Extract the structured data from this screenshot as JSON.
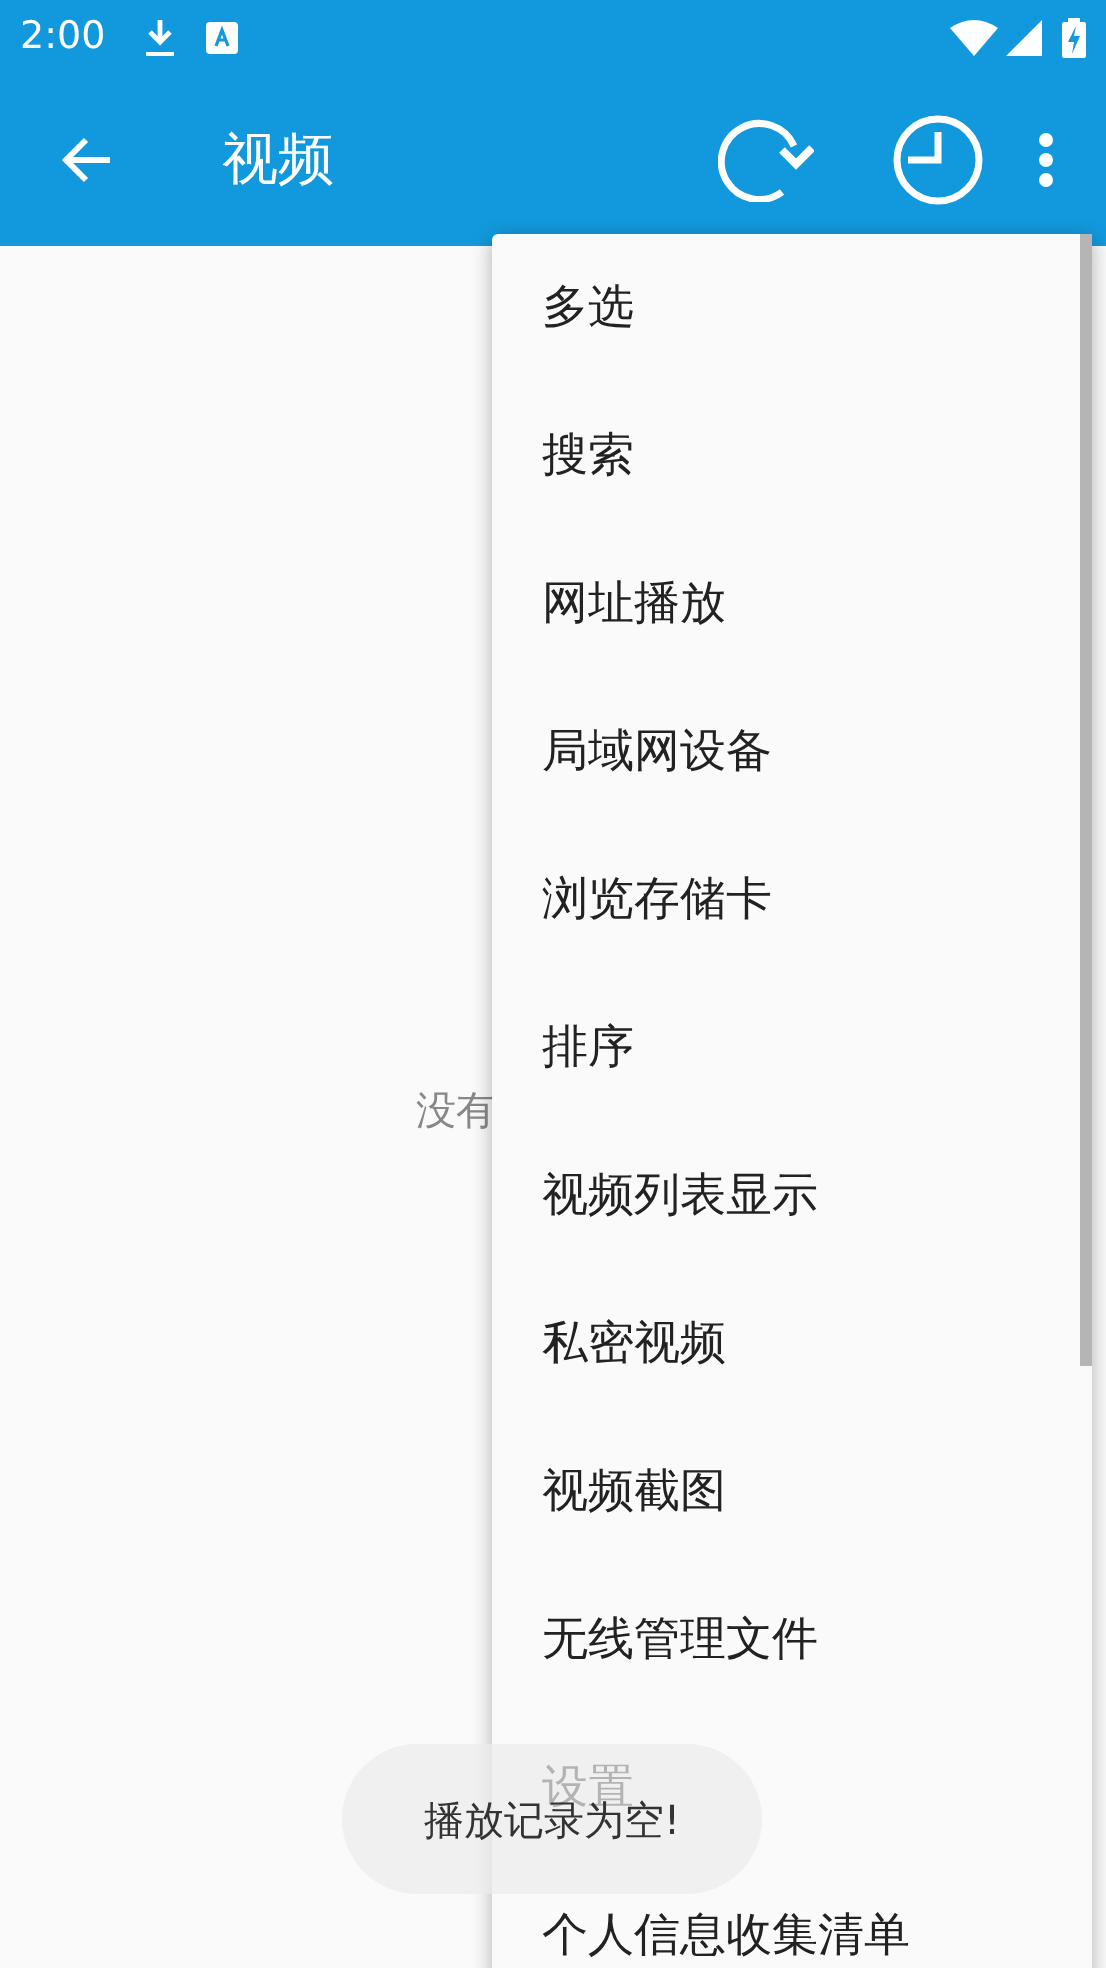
{
  "status_bar": {
    "time": "2:00"
  },
  "app_bar": {
    "title": "视频"
  },
  "empty_text": "没有",
  "menu": {
    "items": [
      {
        "label": "多选"
      },
      {
        "label": "搜索"
      },
      {
        "label": "网址播放"
      },
      {
        "label": "局域网设备"
      },
      {
        "label": "浏览存储卡"
      },
      {
        "label": "排序"
      },
      {
        "label": "视频列表显示"
      },
      {
        "label": "私密视频"
      },
      {
        "label": "视频截图"
      },
      {
        "label": "无线管理文件"
      },
      {
        "label": "设置"
      },
      {
        "label": "个人信息收集清单"
      }
    ]
  },
  "toast": "播放记录为空!"
}
